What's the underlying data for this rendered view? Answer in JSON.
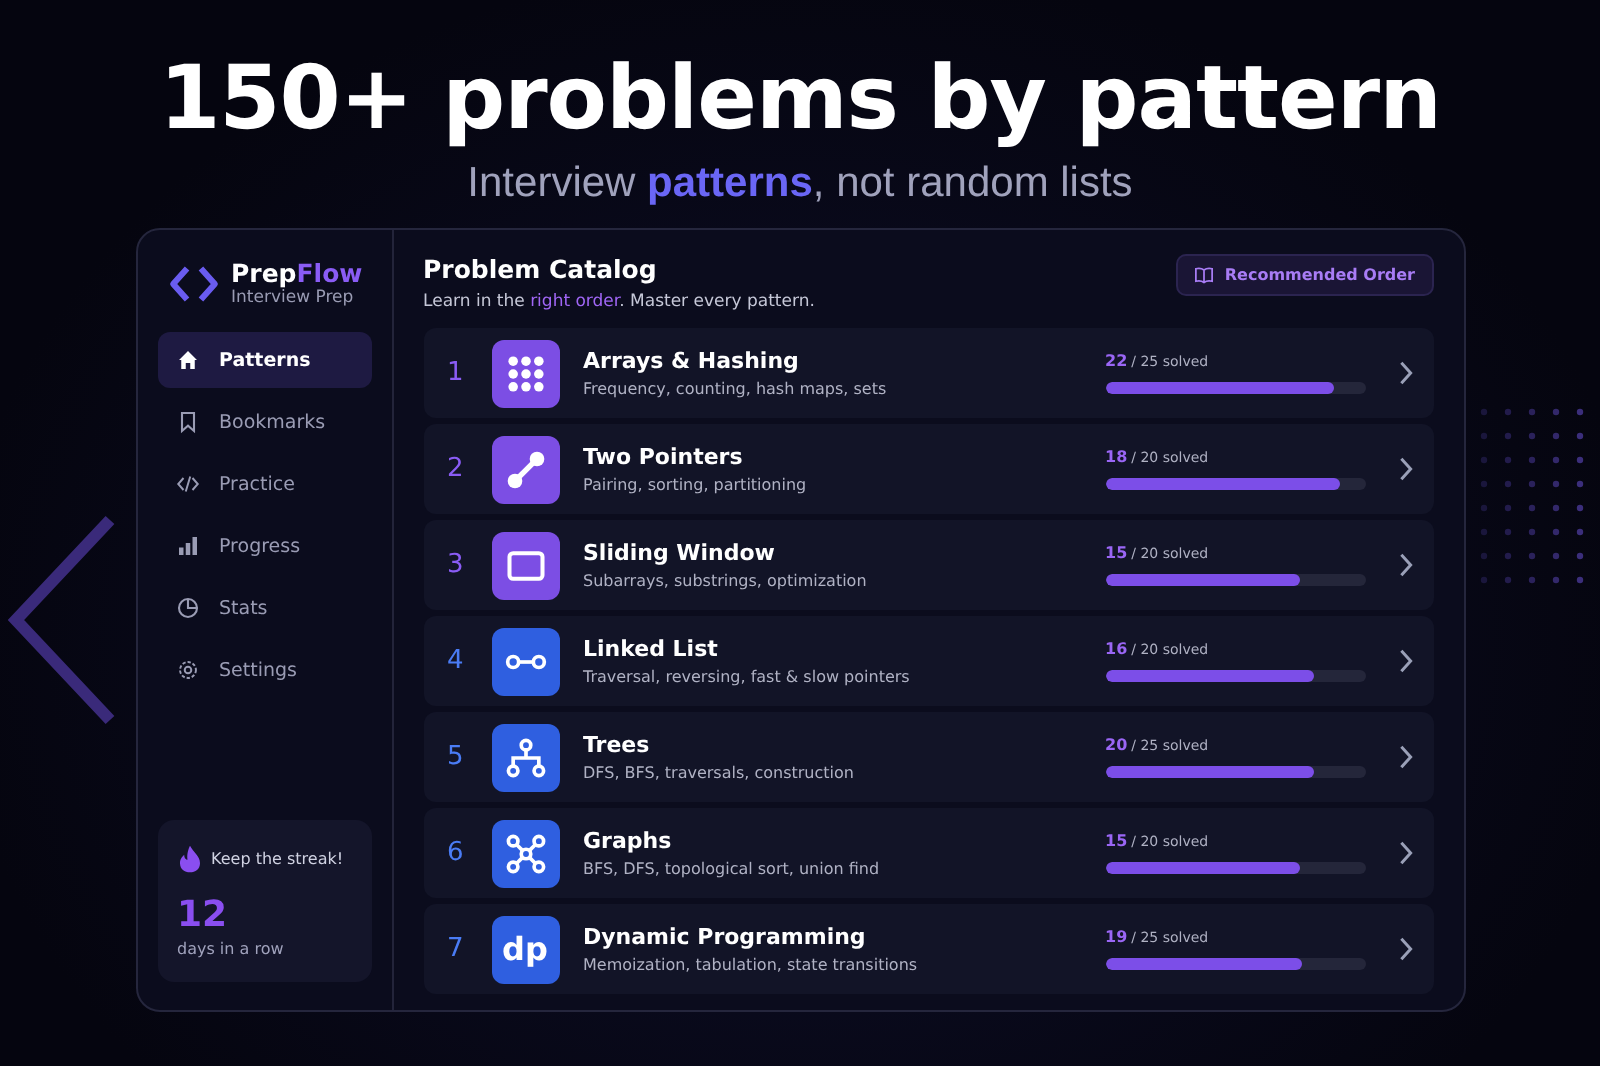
{
  "hero": {
    "title": "150+ problems by pattern",
    "subtitle": "Interview **patterns**, not random lists"
  },
  "brand": {
    "name": "Prep**Flow**",
    "tagline": "Interview Prep"
  },
  "sidebar": {
    "items": [
      {
        "label": "Patterns",
        "kind": "home",
        "selected": true
      },
      {
        "label": "Bookmarks",
        "kind": "bookmark",
        "selected": false
      },
      {
        "label": "Practice",
        "kind": "code",
        "selected": false
      },
      {
        "label": "Progress",
        "kind": "bars",
        "selected": false
      },
      {
        "label": "Stats",
        "kind": "pie",
        "selected": false
      },
      {
        "label": "Settings",
        "kind": "gear",
        "selected": false
      }
    ]
  },
  "streak": {
    "title": "Keep the streak!",
    "count": "12",
    "caption": "days in a row"
  },
  "catalog": {
    "title": "Problem Catalog",
    "subtitle": "Learn in the **right order**. Master every pattern.",
    "button": "Recommended Order"
  },
  "patterns": [
    {
      "number": "1",
      "kind": "grid",
      "color": "#7c4ee4",
      "name": "Arrays & Hashing",
      "description": "Frequency, counting, hash maps, sets",
      "solved": "22",
      "total": "/ 25 solved",
      "level": 0.88
    },
    {
      "number": "2",
      "kind": "link",
      "color": "#7c4ee4",
      "name": "Two Pointers",
      "description": "Pairing, sorting, partitioning",
      "solved": "18",
      "total": "/ 20 solved",
      "level": 0.9
    },
    {
      "number": "3",
      "kind": "window",
      "color": "#7c4ee4",
      "name": "Sliding Window",
      "description": "Subarrays, substrings, optimization",
      "solved": "15",
      "total": "/ 20 solved",
      "level": 0.75
    },
    {
      "number": "4",
      "kind": "chain",
      "color": "#2f5fe0",
      "name": "Linked List",
      "description": "Traversal, reversing, fast & slow pointers",
      "solved": "16",
      "total": "/ 20 solved",
      "level": 0.8
    },
    {
      "number": "5",
      "kind": "tree",
      "color": "#2f5fe0",
      "name": "Trees",
      "description": "DFS, BFS, traversals, construction",
      "solved": "20",
      "total": "/ 25 solved",
      "level": 0.8
    },
    {
      "number": "6",
      "kind": "graph",
      "color": "#2f5fe0",
      "name": "Graphs",
      "description": "BFS, DFS, topological sort, union find",
      "solved": "15",
      "total": "/ 20 solved",
      "level": 0.75
    },
    {
      "number": "7",
      "kind": "text",
      "icon_text": "dp",
      "color": "#2f5fe0",
      "name": "Dynamic Programming",
      "description": "Memoization, tabulation, state transitions",
      "solved": "19",
      "total": "/ 25 solved",
      "level": 0.76
    }
  ]
}
